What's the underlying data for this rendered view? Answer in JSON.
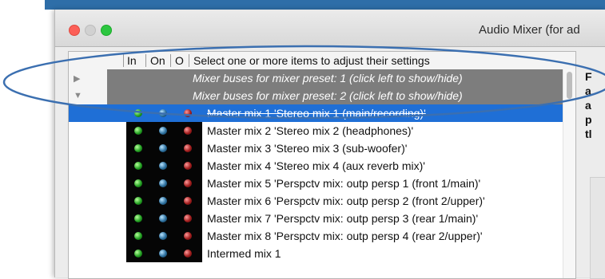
{
  "window": {
    "title": "Audio Mixer (for ad"
  },
  "list": {
    "header": {
      "in": "In",
      "on": "On",
      "o": "O",
      "hint": "Select one or more items to adjust their settings"
    },
    "groups": [
      {
        "label": "Mixer buses for mixer preset: 1 (click left to show/hide)",
        "disclosure": "▶"
      },
      {
        "label": "Mixer buses for mixer preset: 2 (click left to show/hide)",
        "disclosure": "▼"
      }
    ],
    "rows": [
      {
        "label": "Master mix 1 'Stereo mix 1 (main/recording)'"
      },
      {
        "label": "Master mix 2 'Stereo mix 2 (headphones)'"
      },
      {
        "label": "Master mix 3 'Stereo mix 3 (sub-woofer)'"
      },
      {
        "label": "Master mix 4 'Stereo mix 4 (aux reverb mix)'"
      },
      {
        "label": "Master mix 5 'Perspctv mix: outp persp 1 (front 1/main)'"
      },
      {
        "label": "Master mix 6 'Perspctv mix: outp persp 2 (front 2/upper)'"
      },
      {
        "label": "Master mix 7 'Perspctv mix: outp persp 3 (rear 1/main)'"
      },
      {
        "label": "Master mix 8 'Perspctv mix: outp persp 4 (rear 2/upper)'"
      },
      {
        "label": "Intermed mix 1"
      }
    ]
  },
  "side_panel": {
    "lines": [
      "F",
      "a",
      "a",
      "p",
      "tl"
    ]
  },
  "colors": {
    "selection": "#1f6fd6",
    "group_row": "#7d7d7d",
    "annotation_ellipse": "#3b6fb0",
    "led_in": "#22a022",
    "led_on": "#2b6f9d",
    "led_o": "#a01c1c"
  }
}
